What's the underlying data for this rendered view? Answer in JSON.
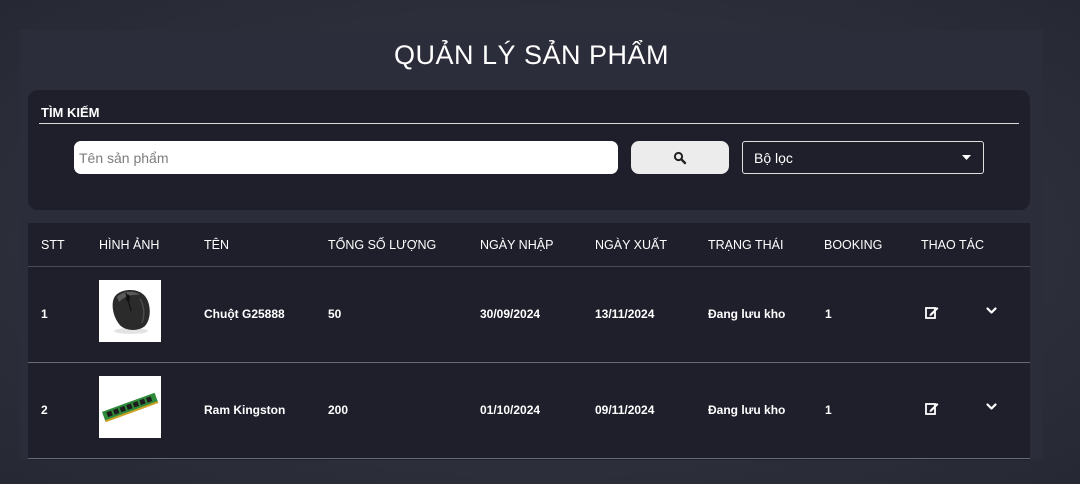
{
  "page": {
    "title": "QUẢN LÝ SẢN PHẨM"
  },
  "search": {
    "label": "TÌM KIẾM",
    "placeholder": "Tên sản phẩm",
    "value": "",
    "button_icon": "search-icon",
    "filter_label": "Bộ lọc"
  },
  "table": {
    "headers": [
      "STT",
      "HÌNH ẢNH",
      "TÊN",
      "TỔNG SỐ LƯỢNG",
      "NGÀY NHẬP",
      "NGÀY XUẤT",
      "TRẠNG THÁI",
      "BOOKING",
      "THAO TÁC"
    ],
    "rows": [
      {
        "stt": "1",
        "image": "computer-mouse",
        "name": "Chuột G25888",
        "quantity": "50",
        "import_date": "30/09/2024",
        "export_date": "13/11/2024",
        "status": "Đang lưu kho",
        "booking": "1"
      },
      {
        "stt": "2",
        "image": "ram-module",
        "name": "Ram Kingston",
        "quantity": "200",
        "import_date": "01/10/2024",
        "export_date": "09/11/2024",
        "status": "Đang lưu kho",
        "booking": "1"
      }
    ]
  },
  "colors": {
    "page_background": "#2d2f3b",
    "panel": "#2c2d3a",
    "card": "#1e1f2b",
    "text": "#ffffff"
  }
}
